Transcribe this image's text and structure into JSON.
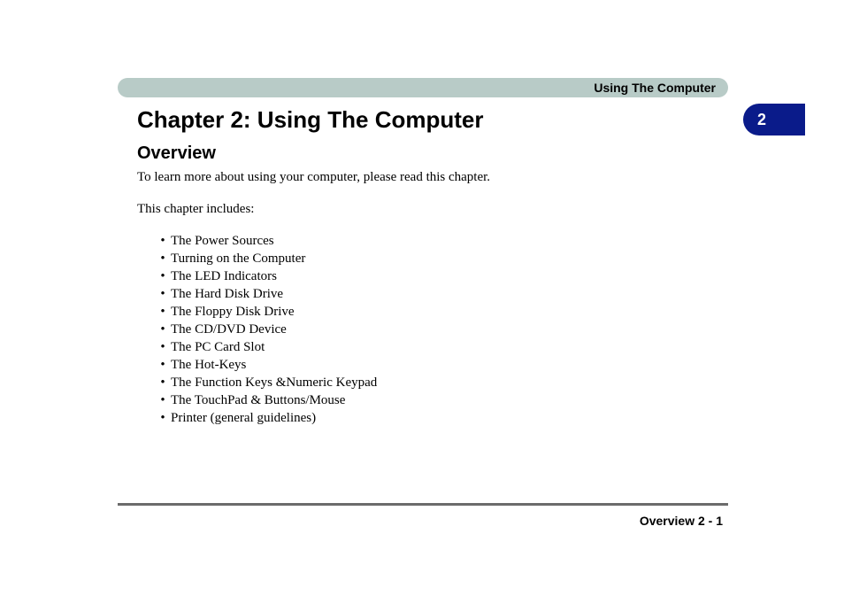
{
  "header": {
    "section": "Using The Computer"
  },
  "tab": {
    "number": "2"
  },
  "title": "Chapter 2: Using The Computer",
  "subtitle": "Overview",
  "intro": "To learn more about using your computer, please read this chapter.",
  "includes_label": "This chapter includes:",
  "bullets": [
    "The Power Sources",
    "Turning on the Computer",
    "The LED Indicators",
    "The Hard Disk Drive",
    "The Floppy Disk Drive",
    "The CD/DVD Device",
    "The PC Card Slot",
    "The Hot-Keys",
    "The Function Keys &Numeric Keypad",
    "The TouchPad & Buttons/Mouse",
    "Printer (general guidelines)"
  ],
  "footer": {
    "text": "Overview  2  -  1"
  }
}
